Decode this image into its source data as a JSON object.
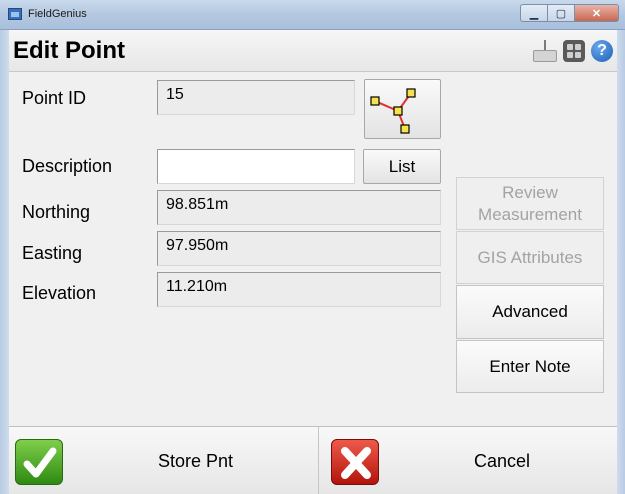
{
  "window": {
    "title": "FieldGenius"
  },
  "header": {
    "title": "Edit Point"
  },
  "form": {
    "point_id_label": "Point ID",
    "point_id_value": "15",
    "description_label": "Description",
    "description_value": "",
    "list_label": "List",
    "northing_label": "Northing",
    "northing_value": "98.851m",
    "easting_label": "Easting",
    "easting_value": "97.950m",
    "elevation_label": "Elevation",
    "elevation_value": "11.210m"
  },
  "side": {
    "review_line1": "Review",
    "review_line2": "Measurement",
    "gis_label": "GIS Attributes",
    "advanced_label": "Advanced",
    "note_label": "Enter Note"
  },
  "bottom": {
    "store_label": "Store Pnt",
    "cancel_label": "Cancel"
  },
  "icons": {
    "title_icon": "app-icon",
    "keyboard": "keyboard-icon",
    "grid": "apps-grid-icon",
    "help": "help-icon",
    "map": "point-network-icon",
    "store": "checkmark-icon",
    "cancel": "close-x-icon"
  },
  "colors": {
    "check_green": "#4fae26",
    "cancel_red": "#d12a1e",
    "disabled_text": "#a3a3a3"
  }
}
